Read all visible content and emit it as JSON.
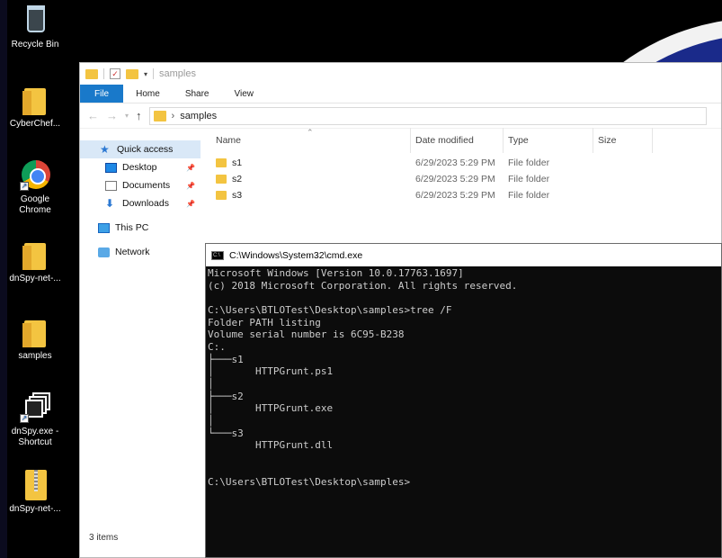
{
  "desktop": {
    "icons": [
      {
        "label": "Recycle Bin"
      },
      {
        "label": "CyberChef..."
      },
      {
        "label": "Google Chrome"
      },
      {
        "label": "dnSpy-net-..."
      },
      {
        "label": "samples"
      },
      {
        "label": "dnSpy.exe - Shortcut"
      },
      {
        "label": "dnSpy-net-..."
      }
    ]
  },
  "explorer": {
    "title": "samples",
    "ribbon_tabs": [
      "File",
      "Home",
      "Share",
      "View"
    ],
    "address": "samples",
    "nav": {
      "quick_access": "Quick access",
      "desktop": "Desktop",
      "documents": "Documents",
      "downloads": "Downloads",
      "this_pc": "This PC",
      "network": "Network"
    },
    "columns": {
      "name": "Name",
      "date": "Date modified",
      "type": "Type",
      "size": "Size"
    },
    "files": [
      {
        "name": "s1",
        "date": "6/29/2023 5:29 PM",
        "type": "File folder"
      },
      {
        "name": "s2",
        "date": "6/29/2023 5:29 PM",
        "type": "File folder"
      },
      {
        "name": "s3",
        "date": "6/29/2023 5:29 PM",
        "type": "File folder"
      }
    ],
    "status": "3 items"
  },
  "cmd": {
    "title": "C:\\Windows\\System32\\cmd.exe",
    "lines": [
      "Microsoft Windows [Version 10.0.17763.1697]",
      "(c) 2018 Microsoft Corporation. All rights reserved.",
      "",
      "C:\\Users\\BTLOTest\\Desktop\\samples>tree /F",
      "Folder PATH listing",
      "Volume serial number is 6C95-B238",
      "C:.",
      "├───s1",
      "│       HTTPGrunt.ps1",
      "│",
      "├───s2",
      "│       HTTPGrunt.exe",
      "│",
      "└───s3",
      "        HTTPGrunt.dll",
      "",
      "",
      "C:\\Users\\BTLOTest\\Desktop\\samples>"
    ]
  }
}
